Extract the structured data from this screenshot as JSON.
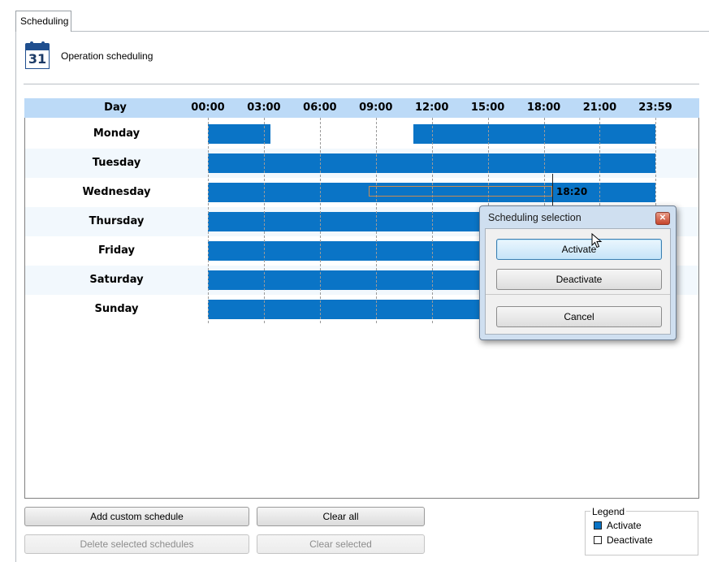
{
  "tab": {
    "label": "Scheduling"
  },
  "header": {
    "icon_number": "31",
    "title": "Operation scheduling",
    "icon": "calendar-icon"
  },
  "grid": {
    "day_header": "Day",
    "time_labels": [
      "00:00",
      "03:00",
      "06:00",
      "09:00",
      "12:00",
      "15:00",
      "18:00",
      "21:00",
      "23:59"
    ],
    "days": [
      {
        "name": "Monday",
        "active_ranges": [
          [
            "00:00",
            "03:20"
          ],
          [
            "11:00",
            "23:59"
          ]
        ]
      },
      {
        "name": "Tuesday",
        "active_ranges": [
          [
            "00:00",
            "23:59"
          ]
        ]
      },
      {
        "name": "Wednesday",
        "active_ranges": [
          [
            "00:00",
            "23:59"
          ]
        ]
      },
      {
        "name": "Thursday",
        "active_ranges": [
          [
            "00:00",
            "23:59"
          ]
        ]
      },
      {
        "name": "Friday",
        "active_ranges": [
          [
            "00:00",
            "23:59"
          ]
        ]
      },
      {
        "name": "Saturday",
        "active_ranges": [
          [
            "00:00",
            "23:59"
          ]
        ]
      },
      {
        "name": "Sunday",
        "active_ranges": [
          [
            "00:00",
            "23:59"
          ]
        ]
      }
    ],
    "selection": {
      "day": "Wednesday",
      "start": "09:00",
      "end": "18:20"
    },
    "cursor_time": "18:20",
    "colors": {
      "active": "#0a74c6",
      "header_bg": "#bcdaf7",
      "alt_row": "#f2f8fd",
      "selection_border": "#c98c52"
    }
  },
  "buttons": {
    "add_custom_schedule": "Add custom schedule",
    "clear_all": "Clear all",
    "delete_selected_schedules": "Delete selected schedules",
    "clear_selected": "Clear selected"
  },
  "legend": {
    "title": "Legend",
    "activate": "Activate",
    "deactivate": "Deactivate"
  },
  "dialog": {
    "title": "Scheduling selection",
    "activate": "Activate",
    "deactivate": "Deactivate",
    "cancel": "Cancel"
  }
}
